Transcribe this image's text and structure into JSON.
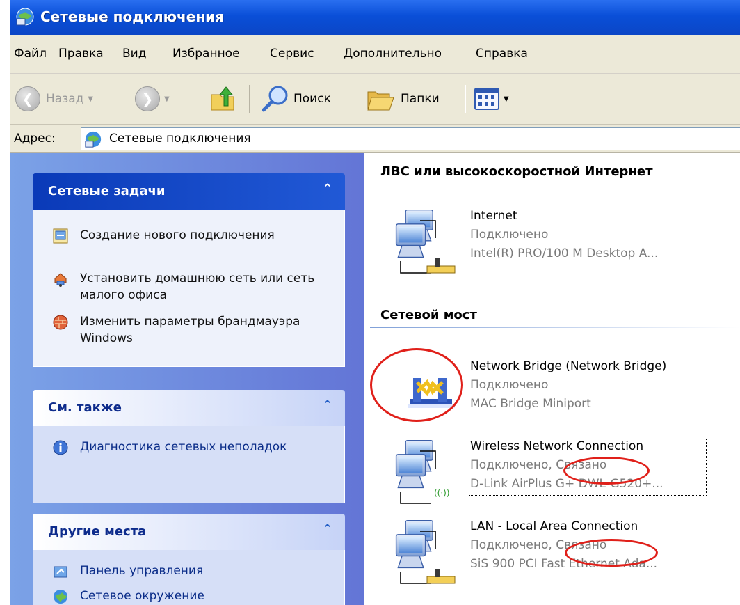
{
  "window": {
    "title": "Сетевые подключения",
    "icon": "network-connections-icon"
  },
  "menu": [
    "Файл",
    "Правка",
    "Вид",
    "Избранное",
    "Сервис",
    "Дополнительно",
    "Справка"
  ],
  "toolbar": {
    "back_label": "Назад",
    "search_label": "Поиск",
    "folders_label": "Папки"
  },
  "address": {
    "label": "Адрес:",
    "value": "Сетевые подключения"
  },
  "panels": [
    {
      "title": "Сетевые задачи",
      "items": [
        {
          "label": "Создание нового подключения",
          "icon": "new-connection-icon"
        },
        {
          "label": "Установить домашнюю сеть или сеть малого офиса",
          "icon": "home-network-icon"
        },
        {
          "label": "Изменить параметры брандмауэра Windows",
          "icon": "firewall-icon"
        }
      ]
    },
    {
      "title": "См. также",
      "items": [
        {
          "label": "Диагностика сетевых неполадок",
          "icon": "info-icon"
        }
      ]
    },
    {
      "title": "Другие места",
      "items": [
        {
          "label": "Панель управления",
          "icon": "control-panel-icon"
        },
        {
          "label": "Сетевое окружение",
          "icon": "network-places-icon"
        }
      ]
    }
  ],
  "groups": [
    {
      "title": "ЛВС или высокоскоростной Интернет",
      "connections": [
        {
          "name": "Internet",
          "status": "Подключено",
          "device": "Intel(R) PRO/100 M Desktop A...",
          "icon": "lan-connection-icon"
        }
      ]
    },
    {
      "title": "Сетевой мост",
      "connections": [
        {
          "name": "Network Bridge (Network Bridge)",
          "status": "Подключено",
          "device": "MAC Bridge Miniport",
          "icon": "network-bridge-icon"
        },
        {
          "name": "Wireless Network Connection",
          "status": "Подключено, Связано",
          "device": "D-Link AirPlus G+ DWL-G520+...",
          "icon": "wireless-connection-icon"
        },
        {
          "name": "LAN - Local Area Connection",
          "status": "Подключено, Связано",
          "device": "SiS 900 PCI Fast Ethernet Ada...",
          "icon": "lan-connection-icon"
        }
      ]
    }
  ],
  "colors": {
    "titlebar": "#0a4fd8",
    "taskpane": "#7ba2e7",
    "highlight_ring": "#e0201a"
  }
}
